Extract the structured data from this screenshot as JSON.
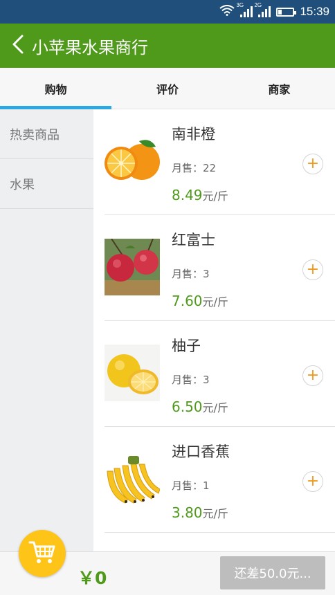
{
  "status_bar": {
    "time": "15:39",
    "network1": "3G",
    "network2": "2G"
  },
  "header": {
    "title": "小苹果水果商行"
  },
  "tabs": [
    {
      "label": "购物",
      "active": true
    },
    {
      "label": "评价",
      "active": false
    },
    {
      "label": "商家",
      "active": false
    }
  ],
  "sidebar": {
    "items": [
      {
        "label": "热卖商品"
      },
      {
        "label": "水果"
      }
    ]
  },
  "products": [
    {
      "name": "南非橙",
      "sold": "月售：22",
      "price": "8.49",
      "unit": "元/斤",
      "image": "orange-image",
      "add": "+"
    },
    {
      "name": "红富士",
      "sold": "月售：3",
      "price": "7.60",
      "unit": "元/斤",
      "image": "apple-image",
      "add": "+"
    },
    {
      "name": "柚子",
      "sold": "月售：3",
      "price": "6.50",
      "unit": "元/斤",
      "image": "pomelo-image",
      "add": "+"
    },
    {
      "name": "进口香蕉",
      "sold": "月售：1",
      "price": "3.80",
      "unit": "元/斤",
      "image": "banana-image",
      "add": "+"
    }
  ],
  "cart": {
    "total": "￥0",
    "checkout_label": "还差50.0元..."
  },
  "colors": {
    "header": "#4f9a1b",
    "status_bar": "#1f4f7a",
    "tab_indicator": "#2fa8e0",
    "price": "#4f9a1b",
    "add_button": "#f39a1c",
    "cart_button": "#ffc418"
  }
}
